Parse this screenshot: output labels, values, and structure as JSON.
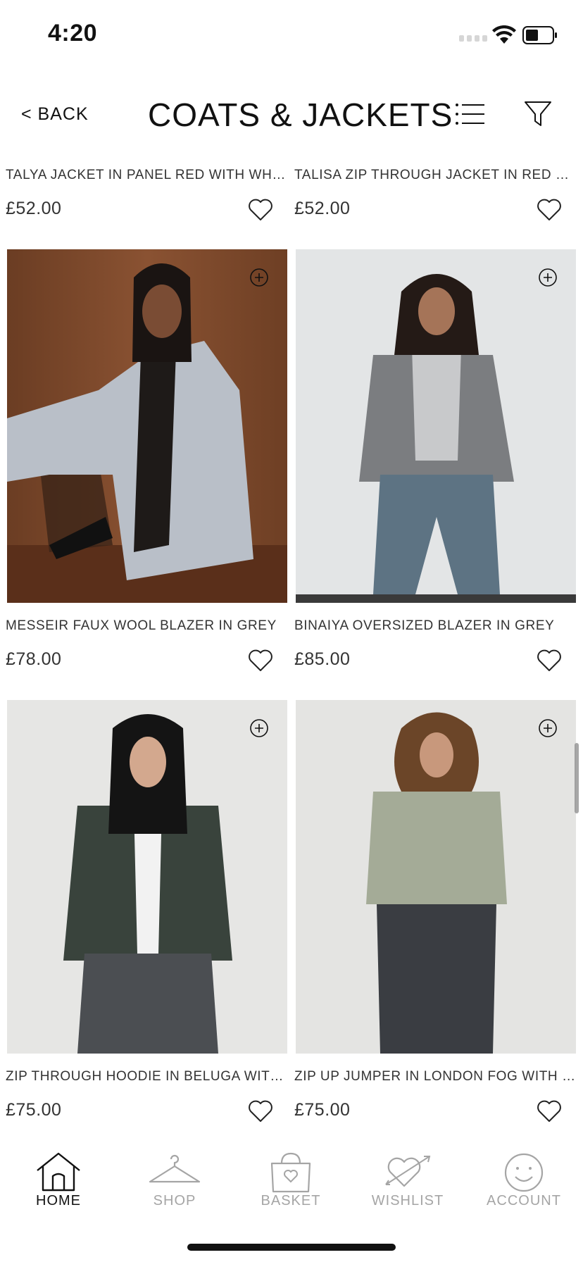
{
  "status_bar": {
    "time": "4:20"
  },
  "header": {
    "back_label": "< BACK",
    "title": "COATS & JACKETS"
  },
  "products": [
    {
      "name": "TALYA JACKET IN PANEL RED WITH WHITE",
      "price": "£52.00"
    },
    {
      "name": "TALISA ZIP THROUGH JACKET IN RED WITH WHITE",
      "price": "£52.00"
    },
    {
      "name": "MESSEIR FAUX WOOL BLAZER IN GREY",
      "price": "£78.00"
    },
    {
      "name": "BINAIYA OVERSIZED BLAZER IN GREY",
      "price": "£85.00"
    },
    {
      "name": "ZIP THROUGH HOODIE IN BELUGA WITH 'M' EMBROIDERY",
      "price": "£75.00"
    },
    {
      "name": "ZIP UP JUMPER IN LONDON FOG WITH 'MOTEL' EMBROIDERY",
      "price": "£75.00"
    }
  ],
  "tab_bar": {
    "tabs": [
      {
        "label": "HOME",
        "icon": "home-icon",
        "active": true
      },
      {
        "label": "SHOP",
        "icon": "hanger-icon",
        "active": false
      },
      {
        "label": "BASKET",
        "icon": "basket-icon",
        "active": false
      },
      {
        "label": "WISHLIST",
        "icon": "heart-arrow-icon",
        "active": false
      },
      {
        "label": "ACCOUNT",
        "icon": "smiley-icon",
        "active": false
      }
    ]
  },
  "colors": {
    "text": "#222222",
    "inactive_tab": "#a5a5a5",
    "background": "#ffffff"
  }
}
